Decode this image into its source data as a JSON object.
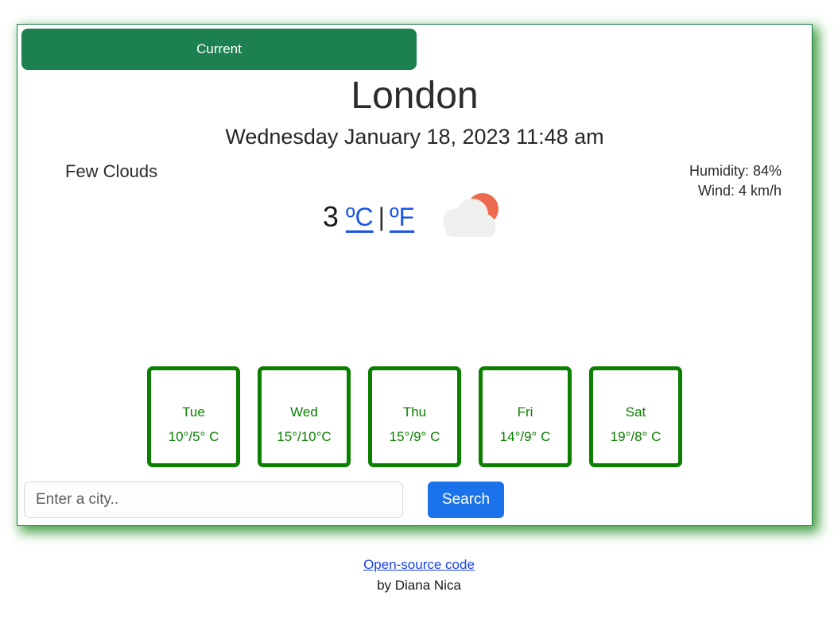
{
  "tabs": {
    "current_label": "Current"
  },
  "current": {
    "city": "London",
    "datetime": "Wednesday January 18, 2023 11:48 am",
    "description": "Few Clouds",
    "temperature": "3",
    "unit_celsius": "ºC",
    "unit_separator": "|",
    "unit_fahrenheit": "ºF",
    "humidity": "Humidity: 84%",
    "wind": "Wind: 4 km/h",
    "icon": "sun-behind-cloud-icon"
  },
  "forecast": [
    {
      "day": "Tue",
      "temps": "10°/5° C"
    },
    {
      "day": "Wed",
      "temps": "15°/10°C"
    },
    {
      "day": "Thu",
      "temps": "15°/9° C"
    },
    {
      "day": "Fri",
      "temps": "14°/9° C"
    },
    {
      "day": "Sat",
      "temps": "19°/8° C"
    }
  ],
  "search": {
    "value": "",
    "placeholder": "Enter a city..",
    "button_label": "Search"
  },
  "footer": {
    "link_label": "Open-source code",
    "author": "by Diana Nica"
  },
  "colors": {
    "tab_green": "#1d8050",
    "card_border_green": "#0b8000",
    "container_border_green": "#1d7d4c",
    "link_blue": "#1a55e8",
    "button_blue": "#1a73ea",
    "icon_sun": "#ec6b4e",
    "icon_cloud": "#efefed"
  }
}
